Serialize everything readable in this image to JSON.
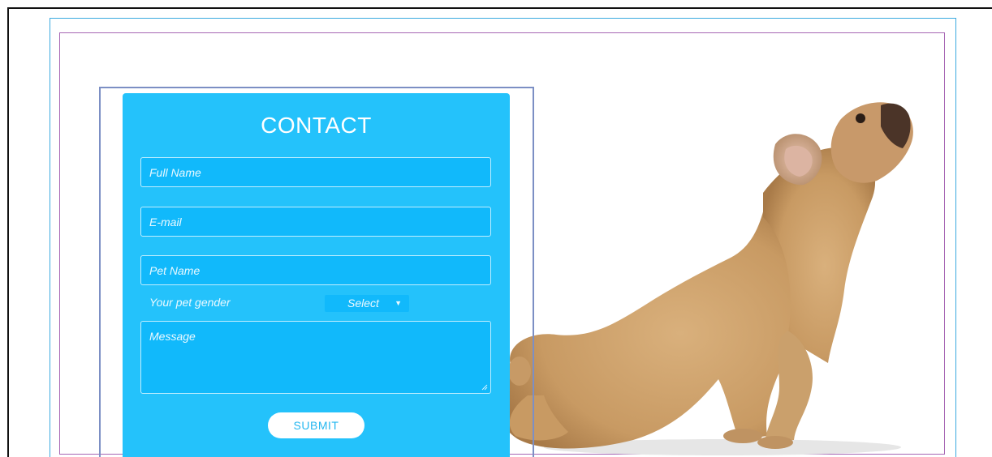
{
  "form": {
    "title": "CONTACT",
    "full_name_placeholder": "Full Name",
    "email_placeholder": "E-mail",
    "pet_name_placeholder": "Pet Name",
    "gender_label": "Your pet gender",
    "gender_select_value": "Select",
    "gender_select_arrow": "▼",
    "message_placeholder": "Message",
    "submit_label": "SUBMIT"
  },
  "colors": {
    "panel_bg": "#24c2fb",
    "field_bg": "#11b9fb",
    "submit_text": "#24b7f0",
    "guide_blue": "#3aa9e0",
    "guide_purple": "#a766b4",
    "selection_outline": "#7c8fc4"
  },
  "icons": {
    "dropdown_arrow": "chevron-down-icon",
    "resize_handle": "resize-grip-icon"
  }
}
